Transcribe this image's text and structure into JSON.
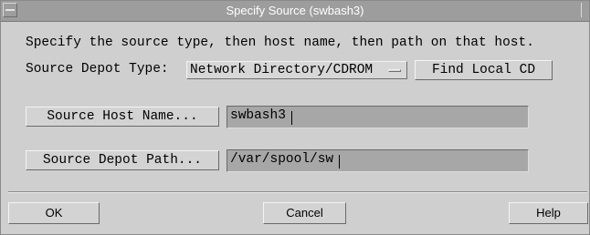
{
  "window": {
    "title": "Specify Source (swbash3)"
  },
  "instructions": "Specify the source type, then host name, then path on that host.",
  "depot_type": {
    "label": "Source Depot Type:",
    "selected": "Network Directory/CDROM",
    "find_local_cd": "Find Local CD"
  },
  "host": {
    "button_label": "Source Host Name...",
    "value": "swbash3"
  },
  "path": {
    "button_label": "Source Depot Path...",
    "value": "/var/spool/sw"
  },
  "footer": {
    "ok": "OK",
    "cancel": "Cancel",
    "help": "Help"
  },
  "icons": {
    "window_menu": "window-menu-icon",
    "option_indicator": "option-menu-indicator-icon"
  }
}
